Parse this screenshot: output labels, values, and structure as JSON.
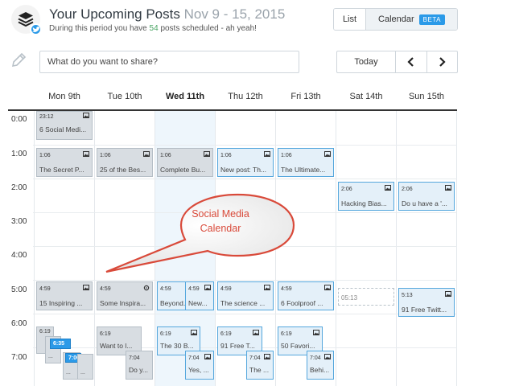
{
  "header": {
    "title": "Your Upcoming Posts",
    "date_range": "Nov 9 - 15, 2015",
    "subtitle_prefix": "During this period you have",
    "scheduled_count": "54",
    "subtitle_suffix": "posts scheduled - ah yeah!",
    "view_list": "List",
    "view_calendar": "Calendar",
    "beta_badge": "BETA"
  },
  "composer": {
    "placeholder": "What do you want to share?"
  },
  "navigation": {
    "today_label": "Today",
    "prev_icon": "chevron-left-icon",
    "next_icon": "chevron-right-icon"
  },
  "days": [
    {
      "label": "Mon 9th",
      "today": false
    },
    {
      "label": "Tue 10th",
      "today": false
    },
    {
      "label": "Wed 11th",
      "today": true
    },
    {
      "label": "Thu 12th",
      "today": false
    },
    {
      "label": "Fri 13th",
      "today": false
    },
    {
      "label": "Sat 14th",
      "today": false
    },
    {
      "label": "Sun 15th",
      "today": false
    }
  ],
  "hours": [
    "0:00",
    "1:00",
    "2:00",
    "3:00",
    "4:00",
    "5:00",
    "6:00",
    "7:00"
  ],
  "posts": {
    "mon_2312": {
      "time": "23:12",
      "text": "6 Social Medi..."
    },
    "mon_0106": {
      "time": "1:06",
      "text": "The Secret P..."
    },
    "tue_0106": {
      "time": "1:06",
      "text": "25 of the Bes..."
    },
    "wed_0106": {
      "time": "1:06",
      "text": "Complete Bu..."
    },
    "thu_0106": {
      "time": "1:06",
      "text": "New post: Th..."
    },
    "fri_0106": {
      "time": "1:06",
      "text": "The Ultimate..."
    },
    "sat_0206": {
      "time": "2:06",
      "text": "Hacking Bias..."
    },
    "sun_0206": {
      "time": "2:06",
      "text": "Do u have a '..."
    },
    "mon_0459": {
      "time": "4:59",
      "text": "15 Inspiring ..."
    },
    "tue_0459": {
      "time": "4:59",
      "text": "Some Inspira..."
    },
    "wed_0459a": {
      "time": "4:59",
      "text": "Beyond..."
    },
    "wed_0459b": {
      "time": "4:59",
      "text": "New..."
    },
    "thu_0459": {
      "time": "4:59",
      "text": "The science ..."
    },
    "fri_0459": {
      "time": "4:59",
      "text": "6 Foolproof ..."
    },
    "sat_0513": {
      "time": "05:13",
      "text": ""
    },
    "sun_0513": {
      "time": "5:13",
      "text": "91 Free Twitt..."
    },
    "mon_0619": {
      "time": "6:19",
      "text": ""
    },
    "mon_0635": {
      "time": "6:35",
      "text": ""
    },
    "mon_0700": {
      "time": "7:00",
      "text": "..."
    },
    "mon_dots1": {
      "time": "",
      "text": "..."
    },
    "mon_dots2": {
      "time": "",
      "text": "..."
    },
    "tue_0619": {
      "time": "6:19",
      "text": "Want to l..."
    },
    "tue_0704": {
      "time": "7:04",
      "text": "Do y..."
    },
    "wed_0619": {
      "time": "6:19",
      "text": "The 30 B..."
    },
    "wed_0704": {
      "time": "7:04",
      "text": "Yes, ..."
    },
    "thu_0619": {
      "time": "6:19",
      "text": "91 Free T..."
    },
    "thu_0704": {
      "time": "7:04",
      "text": "The ..."
    },
    "fri_0619": {
      "time": "6:19",
      "text": "50 Favori..."
    },
    "fri_0704": {
      "time": "7:04",
      "text": "Behi..."
    }
  },
  "callout": {
    "line1": "Social Media",
    "line2": "Calendar",
    "color": "#d94a3a"
  },
  "colors": {
    "accent": "#2b9ae8",
    "count_green": "#4aa564",
    "scheduled_border": "#55a7dd"
  }
}
